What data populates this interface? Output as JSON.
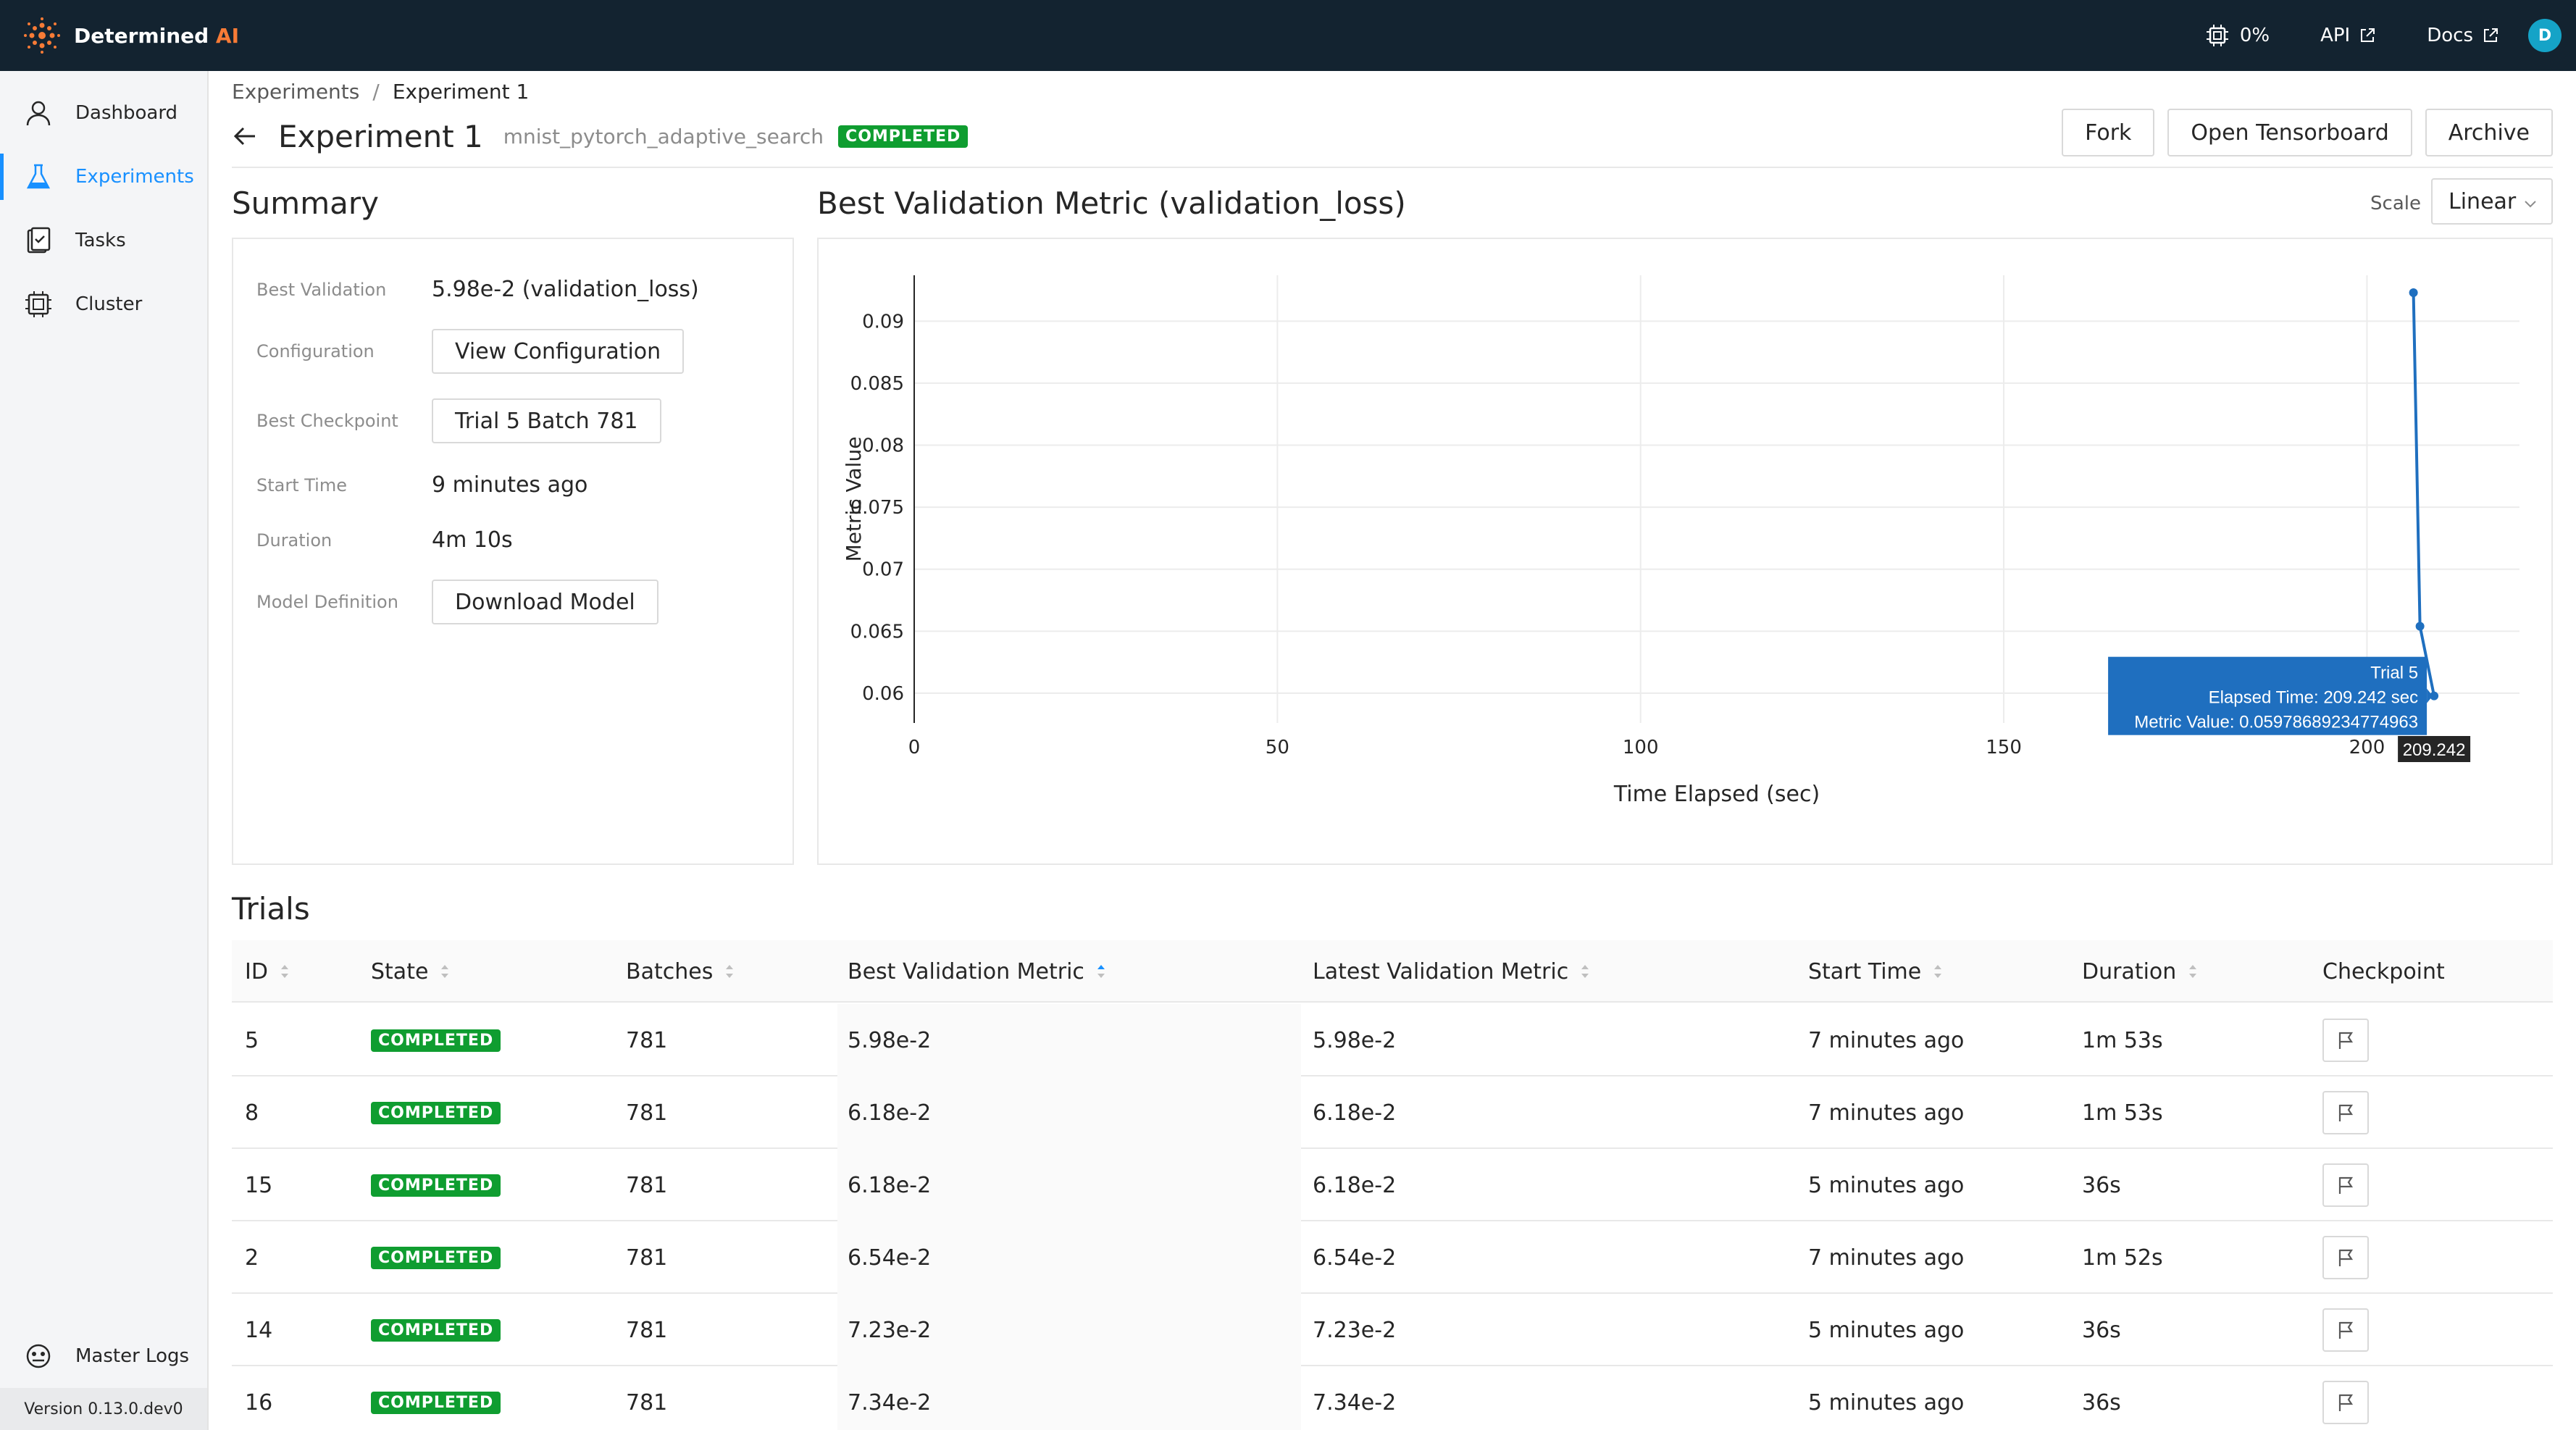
{
  "brand": {
    "name": "Determined",
    "suffix": "AI"
  },
  "topbar": {
    "cluster_usage": "0%",
    "api_label": "API",
    "docs_label": "Docs",
    "avatar_initial": "D"
  },
  "sidebar": {
    "items": [
      {
        "label": "Dashboard",
        "icon": "user-icon"
      },
      {
        "label": "Experiments",
        "icon": "flask-icon",
        "active": true
      },
      {
        "label": "Tasks",
        "icon": "tasks-icon"
      },
      {
        "label": "Cluster",
        "icon": "cluster-icon"
      }
    ],
    "master_logs": "Master Logs",
    "version": "Version 0.13.0.dev0"
  },
  "breadcrumb": {
    "parent": "Experiments",
    "separator": "/",
    "current": "Experiment 1"
  },
  "header": {
    "title": "Experiment 1",
    "subtitle": "mnist_pytorch_adaptive_search",
    "status": "COMPLETED",
    "buttons": {
      "fork": "Fork",
      "tensorboard": "Open Tensorboard",
      "archive": "Archive"
    }
  },
  "summary": {
    "title": "Summary",
    "best_validation_label": "Best Validation",
    "best_validation_value": "5.98e-2 (validation_loss)",
    "configuration_label": "Configuration",
    "configuration_button": "View Configuration",
    "best_checkpoint_label": "Best Checkpoint",
    "best_checkpoint_button": "Trial 5 Batch 781",
    "start_time_label": "Start Time",
    "start_time_value": "9 minutes ago",
    "duration_label": "Duration",
    "duration_value": "4m 10s",
    "model_definition_label": "Model Definition",
    "model_definition_button": "Download Model"
  },
  "chart_section": {
    "title": "Best Validation Metric (validation_loss)",
    "scale_label": "Scale",
    "scale_value": "Linear"
  },
  "chart_data": {
    "type": "line",
    "title": "Best Validation Metric (validation_loss)",
    "xlabel": "Time Elapsed (sec)",
    "ylabel": "Metric Value",
    "xlim": [
      0,
      221
    ],
    "ylim": [
      0.0576,
      0.0937
    ],
    "x_ticks": [
      "0",
      "50",
      "100",
      "150",
      "200"
    ],
    "x_tick_values": [
      0,
      50,
      100,
      150,
      200
    ],
    "y_ticks": [
      "0.06",
      "0.065",
      "0.07",
      "0.075",
      "0.08",
      "0.085",
      "0.09"
    ],
    "y_tick_values": [
      0.06,
      0.065,
      0.07,
      0.075,
      0.08,
      0.085,
      0.09
    ],
    "grid": true,
    "series": [
      {
        "color": "#1f6fbf",
        "points": [
          {
            "x": 206.4,
            "y": 0.0923
          },
          {
            "x": 207.3,
            "y": 0.0654
          },
          {
            "x": 209.242,
            "y": 0.05978
          }
        ]
      }
    ],
    "tooltip": {
      "x": 209.242,
      "y": 0.05978,
      "line1": "Trial 5",
      "line2": "Elapsed Time: 209.242 sec",
      "line3": "Metric Value: 0.05978689234774963",
      "x_label": "209.242"
    }
  },
  "trials": {
    "title": "Trials",
    "columns": {
      "id": "ID",
      "state": "State",
      "batches": "Batches",
      "best": "Best Validation Metric",
      "latest": "Latest Validation Metric",
      "start": "Start Time",
      "duration": "Duration",
      "checkpoint": "Checkpoint"
    },
    "rows": [
      {
        "id": "5",
        "state": "COMPLETED",
        "batches": "781",
        "best": "5.98e-2",
        "latest": "5.98e-2",
        "start": "7 minutes ago",
        "duration": "1m 53s"
      },
      {
        "id": "8",
        "state": "COMPLETED",
        "batches": "781",
        "best": "6.18e-2",
        "latest": "6.18e-2",
        "start": "7 minutes ago",
        "duration": "1m 53s"
      },
      {
        "id": "15",
        "state": "COMPLETED",
        "batches": "781",
        "best": "6.18e-2",
        "latest": "6.18e-2",
        "start": "5 minutes ago",
        "duration": "36s"
      },
      {
        "id": "2",
        "state": "COMPLETED",
        "batches": "781",
        "best": "6.54e-2",
        "latest": "6.54e-2",
        "start": "7 minutes ago",
        "duration": "1m 52s"
      },
      {
        "id": "14",
        "state": "COMPLETED",
        "batches": "781",
        "best": "7.23e-2",
        "latest": "7.23e-2",
        "start": "5 minutes ago",
        "duration": "36s"
      },
      {
        "id": "16",
        "state": "COMPLETED",
        "batches": "781",
        "best": "7.34e-2",
        "latest": "7.34e-2",
        "start": "5 minutes ago",
        "duration": "36s"
      }
    ]
  },
  "colors": {
    "navbar": "#132330",
    "accent": "#1890ff",
    "completed": "#0f9d30",
    "brand_orange": "#f77b36"
  }
}
